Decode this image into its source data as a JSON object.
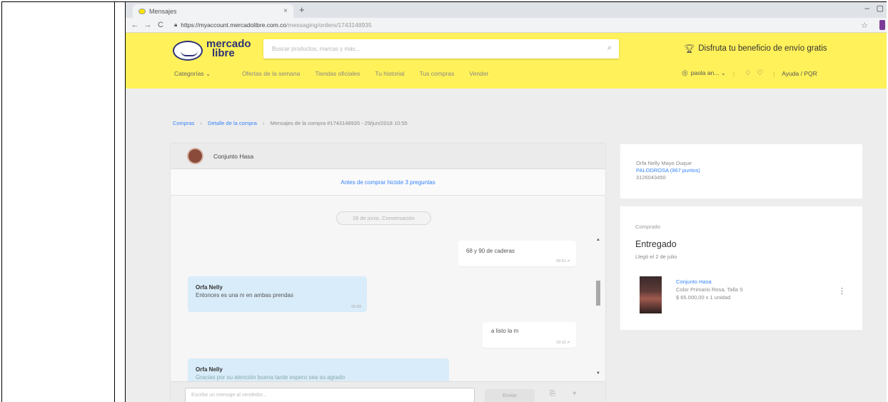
{
  "browser": {
    "tab_title": "Mensajes",
    "tab_close": "×",
    "new_tab": "+",
    "win_min": "–",
    "win_max": "▢",
    "back": "←",
    "forward": "→",
    "reload": "C",
    "url_domain": "https://myaccount.mercadolibre.com.co",
    "url_path": "/messaging/orders/1743148935",
    "star": "☆"
  },
  "header": {
    "logo_line1": "mercado",
    "logo_line2": "libre",
    "search_placeholder": "Buscar productos, marcas y más...",
    "promo_text": "Disfruta tu beneficio de envío gratis",
    "nav": [
      "Categorías ⌄",
      "Ofertas de la semana",
      "Tiendas oficiales",
      "Tu historial",
      "Tus compras",
      "Vender"
    ],
    "user_label": "paola an... ⌄",
    "help_label": "Ayuda / PQR"
  },
  "breadcrumb": {
    "items": [
      "Compras",
      "Detalle de la compra"
    ],
    "current": "Mensajes de la compra #1743148935 - 29/jun/2018 10:55"
  },
  "chat": {
    "seller_name": "Conjunto Hasa",
    "pre_purchase": "Antes de comprar hiciste 3 preguntas",
    "date_pill": "26 de junio, Conversación",
    "messages": [
      {
        "text": "68 y 90 de caderas",
        "time": "09:51 ✔"
      },
      {
        "author": "Orfa Nelly",
        "text": "Entonces es una m en ambas prendas",
        "time": "09:58"
      },
      {
        "text": "a listo la m",
        "time": "10:12 ✔"
      },
      {
        "author": "Orfa Nelly",
        "text": "Gracias por su atención buena tarde espero sea su agrado"
      }
    ],
    "input_placeholder": "Escribe un mensaje al vendedor...",
    "send_label": "Enviar"
  },
  "buyer_card": {
    "name": "Orfa Nelly Mayo Duque",
    "nick": "PALODROSA (967 puntos)",
    "phone": "3126043450"
  },
  "purchase_card": {
    "label": "Comprado",
    "status": "Entregado",
    "arrived": "Llegó el 2 de julio",
    "product_name": "Conjunto Hasa",
    "variation": "Color Primario Rosa, Talla S",
    "price": "$ 65.000,00 x 1 unidad"
  }
}
